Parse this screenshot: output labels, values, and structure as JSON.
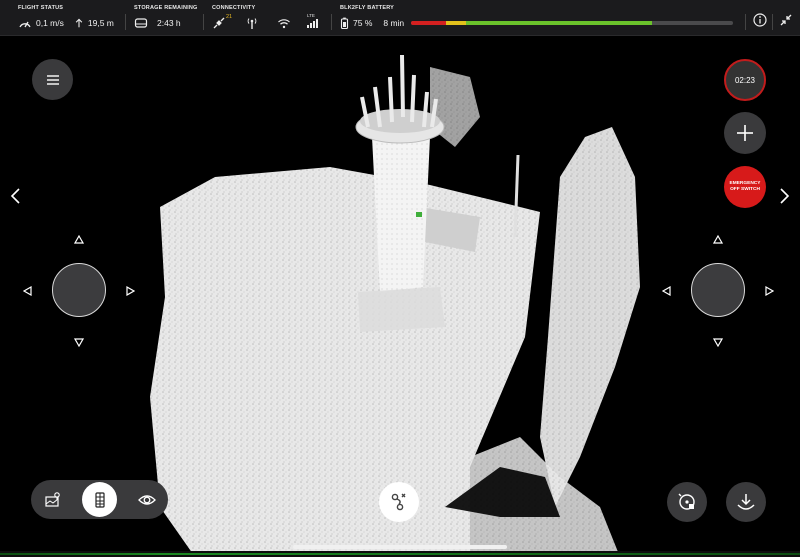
{
  "status_bar": {
    "flight_status": {
      "title": "FLIGHT STATUS",
      "speed": "0,1 m/s",
      "altitude": "19,5 m",
      "speed_icon": "speedometer-icon",
      "altitude_icon": "altitude-arrow-icon"
    },
    "storage": {
      "title": "STORAGE REMAINING",
      "value": "2:43 h",
      "icon": "storage-drive-icon"
    },
    "connectivity": {
      "title": "CONNECTIVITY",
      "satellites": "21",
      "lte_label": "LTE",
      "icons": [
        "satellite-icon",
        "radio-tower-icon",
        "wifi-icon",
        "lte-signal-icon"
      ]
    },
    "battery": {
      "title": "BLK2FLY BATTERY",
      "percent": "75 %",
      "time": "8 min",
      "level_segments": [
        {
          "color": "#d42020",
          "fraction": 0.11
        },
        {
          "color": "#e2c11c",
          "fraction": 0.06
        },
        {
          "color": "#6ac22b",
          "fraction": 0.58
        }
      ]
    },
    "right_icons": [
      "info-icon",
      "collapse-icon"
    ]
  },
  "controls": {
    "timer": "02:23",
    "emergency_label_line1": "EMERGENCY",
    "emergency_label_line2": "OFF SWITCH"
  },
  "mode_bar": {
    "items": [
      "map-pin-icon",
      "point-cloud-icon",
      "eye-icon"
    ],
    "active_index": 1
  },
  "colors": {
    "accent_red": "#d71a1a",
    "panel": "#3a3a3c",
    "statusbar": "#1b1b1d"
  }
}
